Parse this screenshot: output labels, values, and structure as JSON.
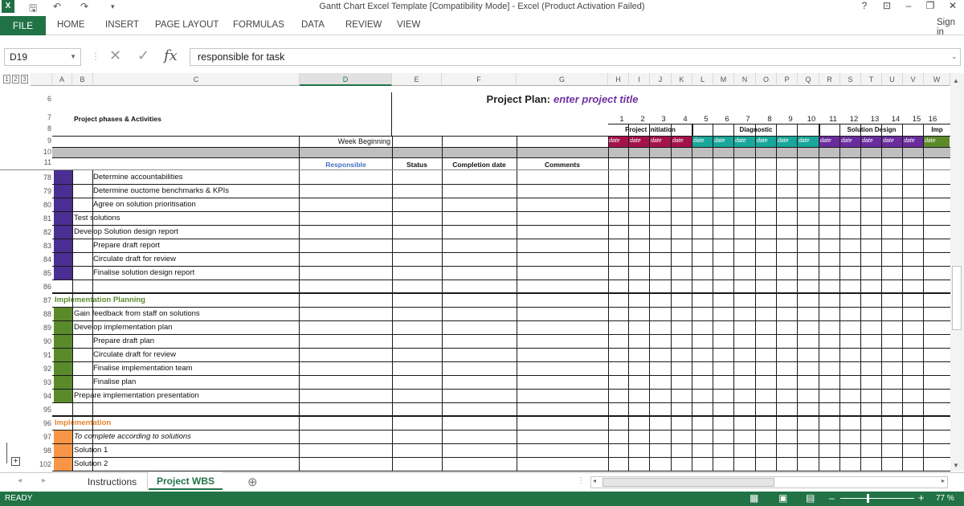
{
  "window": {
    "title": "Gantt Chart Excel Template  [Compatibility Mode] - Excel (Product Activation Failed)",
    "help": "?",
    "sign_in": "Sign in"
  },
  "ribbon": {
    "file": "FILE",
    "tabs": [
      "HOME",
      "INSERT",
      "PAGE LAYOUT",
      "FORMULAS",
      "DATA",
      "REVIEW",
      "VIEW"
    ]
  },
  "formula_bar": {
    "name_box": "D19",
    "formula": "responsible for task"
  },
  "grid": {
    "outline_levels": [
      "1",
      "2",
      "3"
    ],
    "columns": [
      "A",
      "B",
      "C",
      "D",
      "E",
      "F",
      "G",
      "H",
      "I",
      "J",
      "K",
      "L",
      "M",
      "N",
      "O",
      "P",
      "Q",
      "R",
      "S",
      "T",
      "U",
      "V",
      "W"
    ],
    "sheet_title": "Project Plan:",
    "sheet_title_placeholder": "enter project title",
    "phases_header": "Project phases & Activities",
    "week_beginning": "Week Beginning",
    "week_numbers": [
      "1",
      "2",
      "3",
      "4",
      "5",
      "6",
      "7",
      "8",
      "9",
      "10",
      "11",
      "12",
      "13",
      "14",
      "15",
      "16"
    ],
    "phase_groups": [
      "Project initiation",
      "Diagnostic",
      "Solution  Design",
      "Imp"
    ],
    "date_label": "date",
    "col_headers": {
      "responsible": "Responsible",
      "status": "Status",
      "completion": "Completion date",
      "comments": "Comments"
    },
    "rows": [
      {
        "n": "6"
      },
      {
        "n": "7"
      },
      {
        "n": "8"
      },
      {
        "n": "9"
      },
      {
        "n": "10"
      },
      {
        "n": "11"
      },
      {
        "n": "78",
        "text": "Determine accountabilities",
        "indent": 2,
        "color": "#4b2e91"
      },
      {
        "n": "79",
        "text": "Determine ouctome benchmarks &  KPIs",
        "indent": 2,
        "color": "#4b2e91"
      },
      {
        "n": "80",
        "text": "Agree on solution prioritisation",
        "indent": 2,
        "color": "#4b2e91"
      },
      {
        "n": "81",
        "text": "Test solutions",
        "indent": 1,
        "color": "#4b2e91"
      },
      {
        "n": "82",
        "text": "Develop Solution design report",
        "indent": 1,
        "color": "#4b2e91"
      },
      {
        "n": "83",
        "text": "Prepare draft report",
        "indent": 2,
        "color": "#4b2e91"
      },
      {
        "n": "84",
        "text": "Circulate draft for review",
        "indent": 2,
        "color": "#4b2e91"
      },
      {
        "n": "85",
        "text": "Finalise solution design report",
        "indent": 2,
        "color": "#4b2e91"
      },
      {
        "n": "86",
        "text": ""
      },
      {
        "n": "87",
        "text": "Implementation Planning",
        "indent": 0,
        "heading": true,
        "hcolor": "#5b8a2b"
      },
      {
        "n": "88",
        "text": "Gain feedback from staff on solutions",
        "indent": 1,
        "color": "#5b8a2b"
      },
      {
        "n": "89",
        "text": "Develop implementation plan",
        "indent": 1,
        "color": "#5b8a2b"
      },
      {
        "n": "90",
        "text": "Prepare draft plan",
        "indent": 2,
        "color": "#5b8a2b"
      },
      {
        "n": "91",
        "text": "Circulate draft for review",
        "indent": 2,
        "color": "#5b8a2b"
      },
      {
        "n": "92",
        "text": "Finalise implementation team",
        "indent": 2,
        "color": "#5b8a2b"
      },
      {
        "n": "93",
        "text": "Finalise plan",
        "indent": 2,
        "color": "#5b8a2b"
      },
      {
        "n": "94",
        "text": "Prepare implementation presentation",
        "indent": 1,
        "color": "#5b8a2b"
      },
      {
        "n": "95",
        "text": ""
      },
      {
        "n": "96",
        "text": "Implementation",
        "indent": 0,
        "heading": true,
        "hcolor": "#e6832f"
      },
      {
        "n": "97",
        "text": "To complete according to solutions",
        "indent": 1,
        "italic": true,
        "color": "#f79646"
      },
      {
        "n": "98",
        "text": "Solution 1",
        "indent": 1,
        "color": "#f79646"
      },
      {
        "n": "102",
        "text": "Solution 2",
        "indent": 1,
        "color": "#f79646"
      }
    ]
  },
  "sheet_tabs": [
    "Instructions",
    "Project WBS"
  ],
  "status": {
    "ready": "READY",
    "zoom": "77 %"
  },
  "colors": {
    "accent": "#217346",
    "purple": "#4b2e91",
    "green": "#5b8a2b",
    "orange": "#f79646",
    "crimson": "#a4124b",
    "teal": "#1aa69a",
    "violet": "#6a2c9d"
  }
}
